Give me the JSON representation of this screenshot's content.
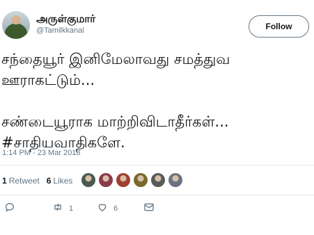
{
  "user": {
    "display_name": "அருள்குமார்",
    "handle": "@Tamilkkanal"
  },
  "follow_label": "Follow",
  "tweet": {
    "lines": [
      "சந்தையூர் இனிமேலாவது சமத்துவ",
      "ஊராகட்டும்...",
      "சண்டையூராக மாற்றிவிடாதீர்கள்...",
      "#சாதியவாதிகளே."
    ],
    "timestamp": "1:14 PM - 23 Mar 2018"
  },
  "stats": {
    "retweets_count": "1",
    "retweets_label": "Retweet",
    "likes_count": "6",
    "likes_label": "Likes"
  },
  "likers": [
    {
      "icon": "liker-avatar",
      "color": "#4a5a4e"
    },
    {
      "icon": "liker-avatar",
      "color": "#8a3a4a"
    },
    {
      "icon": "liker-avatar",
      "color": "#a04030"
    },
    {
      "icon": "liker-avatar",
      "color": "#7a6a2a"
    },
    {
      "icon": "liker-avatar",
      "color": "#5a5a5a"
    },
    {
      "icon": "liker-avatar",
      "color": "#6b7380"
    }
  ],
  "actions": {
    "reply_icon": "reply-icon",
    "retweet_icon": "retweet-icon",
    "retweet_count": "1",
    "like_icon": "heart-icon",
    "like_count": "6",
    "message_icon": "envelope-icon"
  },
  "colors": {
    "text": "#14171a",
    "secondary": "#657786",
    "border": "#e1e8ed"
  }
}
